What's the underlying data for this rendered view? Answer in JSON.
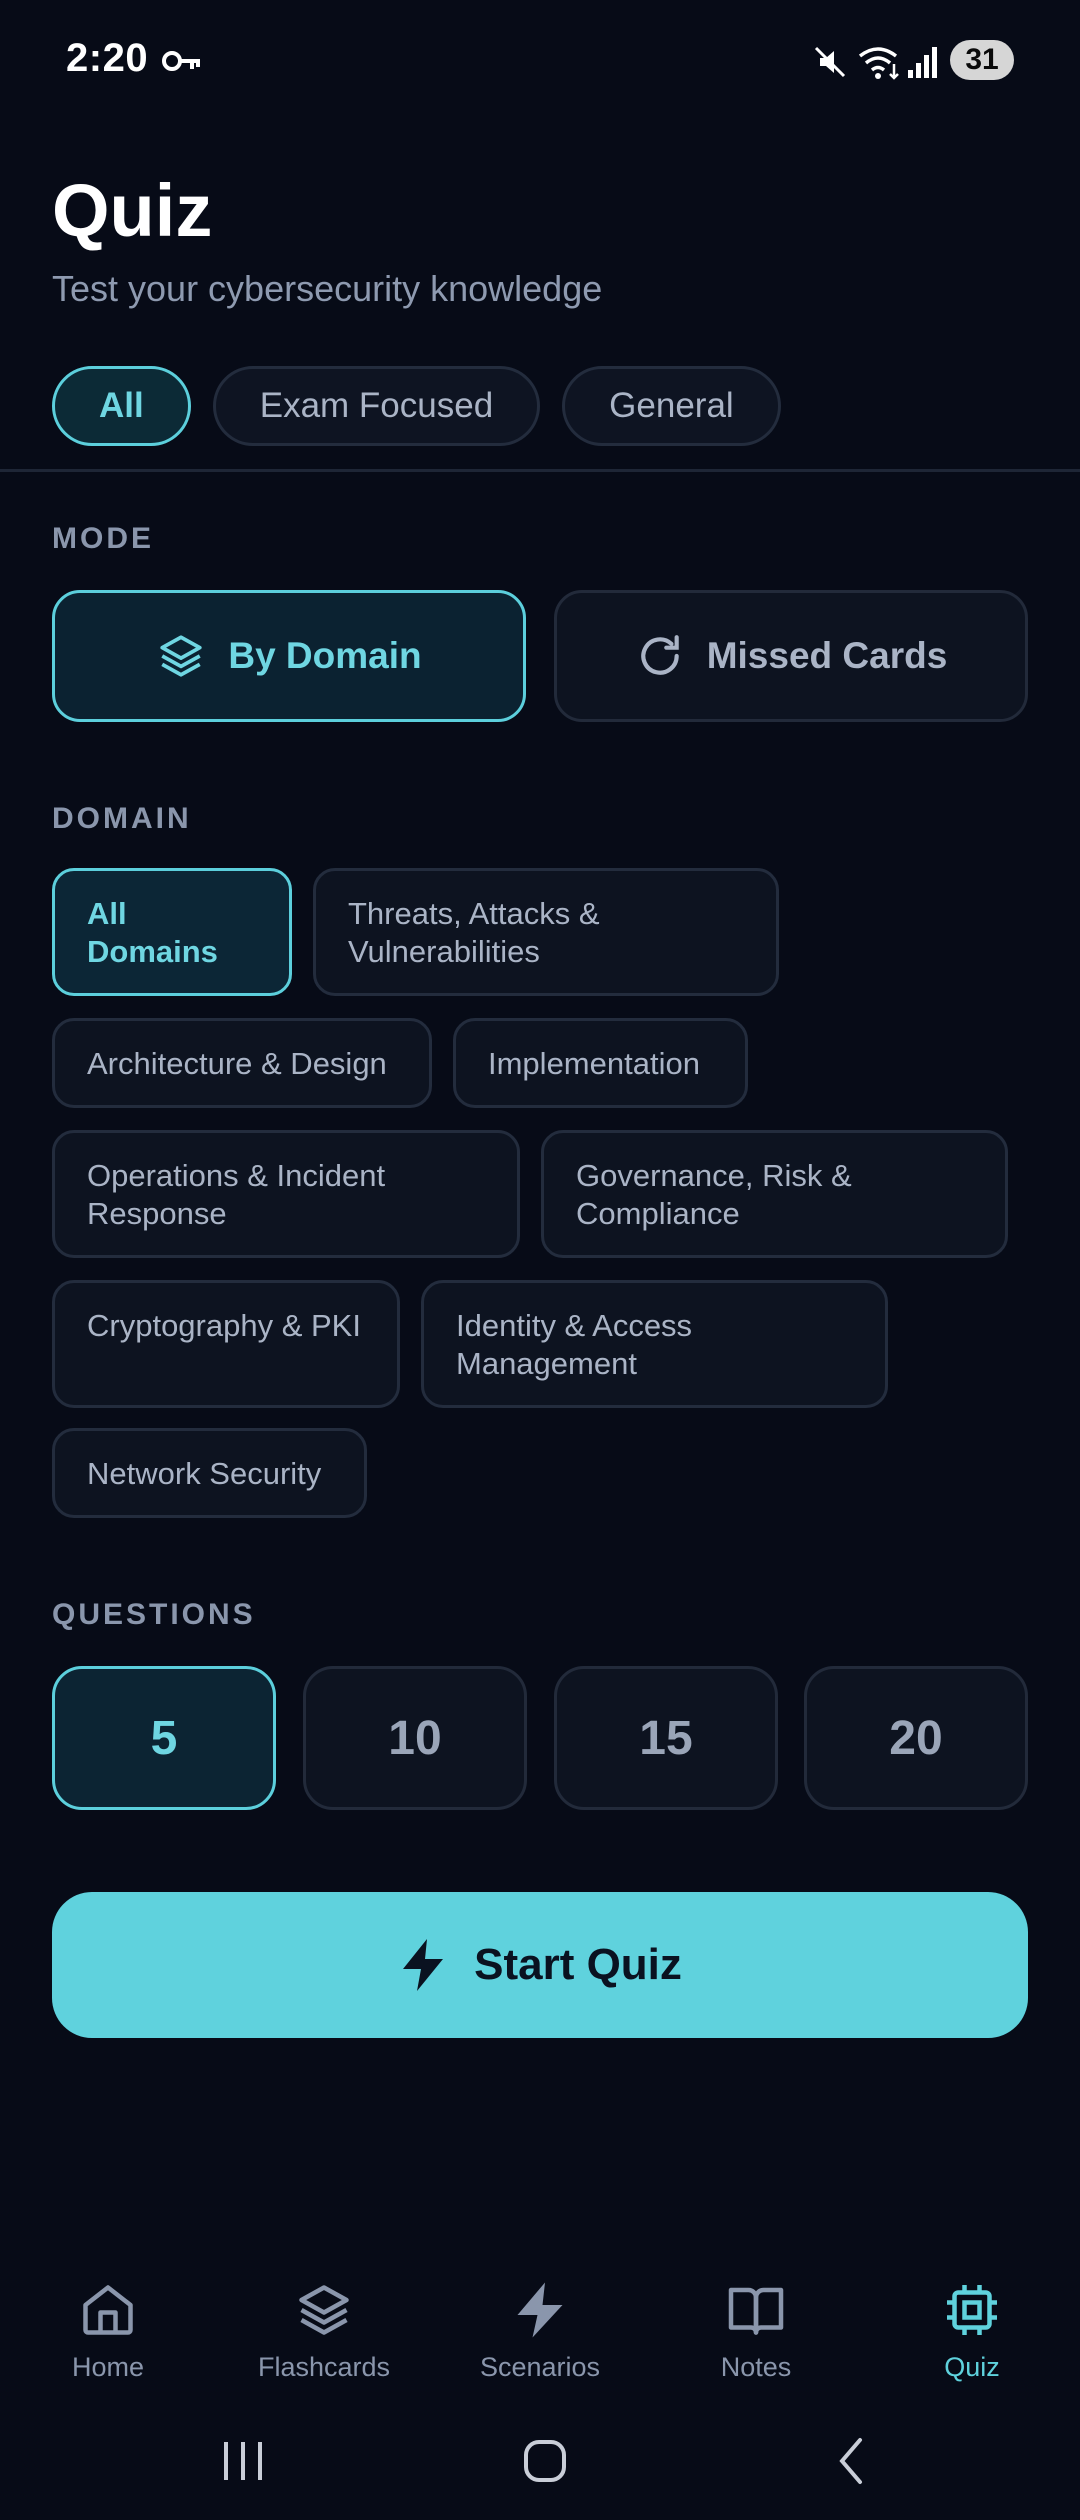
{
  "status_bar": {
    "time": "2:20",
    "battery": "31"
  },
  "header": {
    "title": "Quiz",
    "subtitle": "Test your cybersecurity knowledge"
  },
  "filters": [
    {
      "label": "All",
      "active": true
    },
    {
      "label": "Exam Focused",
      "active": false
    },
    {
      "label": "General",
      "active": false
    }
  ],
  "mode": {
    "label": "MODE",
    "options": [
      {
        "label": "By Domain",
        "icon": "layers-icon",
        "active": true
      },
      {
        "label": "Missed Cards",
        "icon": "refresh-icon",
        "active": false
      }
    ]
  },
  "domain": {
    "label": "DOMAIN",
    "options": [
      {
        "line1": "All Domains",
        "line2": "",
        "active": true
      },
      {
        "line1": "Threats, Attacks &",
        "line2": "Vulnerabilities",
        "active": false
      },
      {
        "line1": "Architecture & Design",
        "line2": "",
        "active": false
      },
      {
        "line1": "Implementation",
        "line2": "",
        "active": false
      },
      {
        "line1": "Operations & Incident",
        "line2": "Response",
        "active": false
      },
      {
        "line1": "Governance, Risk &",
        "line2": "Compliance",
        "active": false
      },
      {
        "line1": "Cryptography & PKI",
        "line2": "",
        "active": false
      },
      {
        "line1": "Identity & Access",
        "line2": "Management",
        "active": false
      },
      {
        "line1": "Network Security",
        "line2": "",
        "active": false
      }
    ]
  },
  "questions": {
    "label": "QUESTIONS",
    "options": [
      {
        "label": "5",
        "active": true
      },
      {
        "label": "10",
        "active": false
      },
      {
        "label": "15",
        "active": false
      },
      {
        "label": "20",
        "active": false
      }
    ]
  },
  "start_button": {
    "label": "Start Quiz",
    "icon": "lightning-icon"
  },
  "bottom_nav": [
    {
      "label": "Home",
      "icon": "home-icon",
      "active": false
    },
    {
      "label": "Flashcards",
      "icon": "layers-icon",
      "active": false
    },
    {
      "label": "Scenarios",
      "icon": "lightning-icon",
      "active": false
    },
    {
      "label": "Notes",
      "icon": "book-icon",
      "active": false
    },
    {
      "label": "Quiz",
      "icon": "chip-icon",
      "active": true
    }
  ],
  "colors": {
    "accent": "#5fd2dd",
    "background": "#070b17",
    "chip_border": "#232c3d"
  }
}
